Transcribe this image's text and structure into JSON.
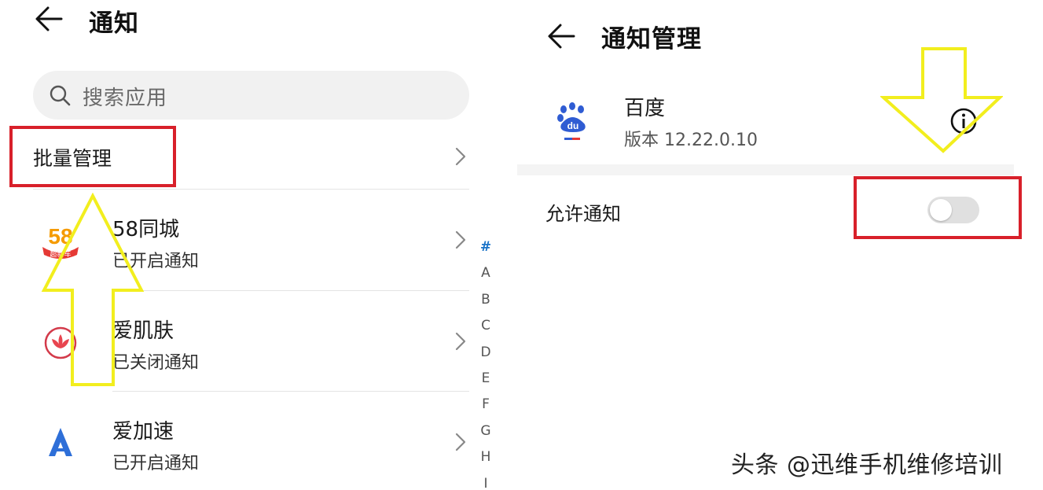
{
  "left": {
    "title": "通知",
    "search": {
      "placeholder": "搜索应用"
    },
    "batch_label": "批量管理",
    "apps": [
      {
        "name": "58同城",
        "status": "已开启通知",
        "icon": "58-tongcheng-icon",
        "icon_text": "58",
        "icon_subtext": "超新车"
      },
      {
        "name": "爱肌肤",
        "status": "已关闭通知",
        "icon": "aijifu-lotus-icon"
      },
      {
        "name": "爱加速",
        "status": "已开启通知",
        "icon": "aijiasu-a-icon"
      }
    ],
    "index_letters": [
      "#",
      "A",
      "B",
      "C",
      "D",
      "E",
      "F",
      "G",
      "H",
      "I"
    ],
    "index_active": "#"
  },
  "right": {
    "title": "通知管理",
    "app": {
      "name": "百度",
      "version": "版本 12.22.0.10",
      "icon": "baidu-paw-icon",
      "icon_text": "du"
    },
    "allow_label": "允许通知",
    "allow_enabled": false
  },
  "watermark": "头条 @迅维手机维修培训",
  "colors": {
    "highlight": "#d8202a",
    "arrow_stroke": "#f2ee1e",
    "toggle_off": "#e0e0e0",
    "index_active": "#1a73c8"
  }
}
